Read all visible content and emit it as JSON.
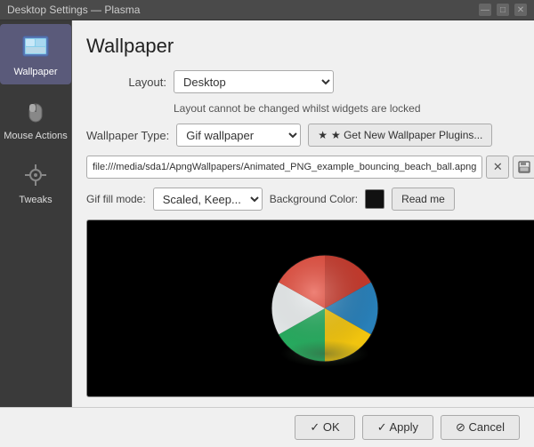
{
  "titlebar": {
    "title": "Desktop Settings — Plasma",
    "min_btn": "—",
    "max_btn": "□",
    "close_btn": "✕"
  },
  "sidebar": {
    "items": [
      {
        "id": "wallpaper",
        "label": "Wallpaper",
        "active": true
      },
      {
        "id": "mouse-actions",
        "label": "Mouse Actions",
        "active": false
      },
      {
        "id": "tweaks",
        "label": "Tweaks",
        "active": false
      }
    ]
  },
  "content": {
    "page_title": "Wallpaper",
    "layout_label": "Layout:",
    "layout_value": "Desktop",
    "lock_warning": "Layout cannot be changed whilst widgets are locked",
    "wallpaper_type_label": "Wallpaper Type:",
    "wallpaper_type_value": "Gif wallpaper",
    "get_plugins_btn": "★ Get New Wallpaper Plugins...",
    "file_path": "file:///media/sda1/ApngWallpapers/Animated_PNG_example_bouncing_beach_ball.apng",
    "gif_fill_label": "Gif fill mode:",
    "gif_fill_value": "Scaled, Keep...",
    "background_color_label": "Background Color:",
    "read_me_btn": "Read me"
  },
  "footer": {
    "ok_btn": "✓ OK",
    "apply_btn": "✓ Apply",
    "cancel_btn": "⊘ Cancel"
  }
}
